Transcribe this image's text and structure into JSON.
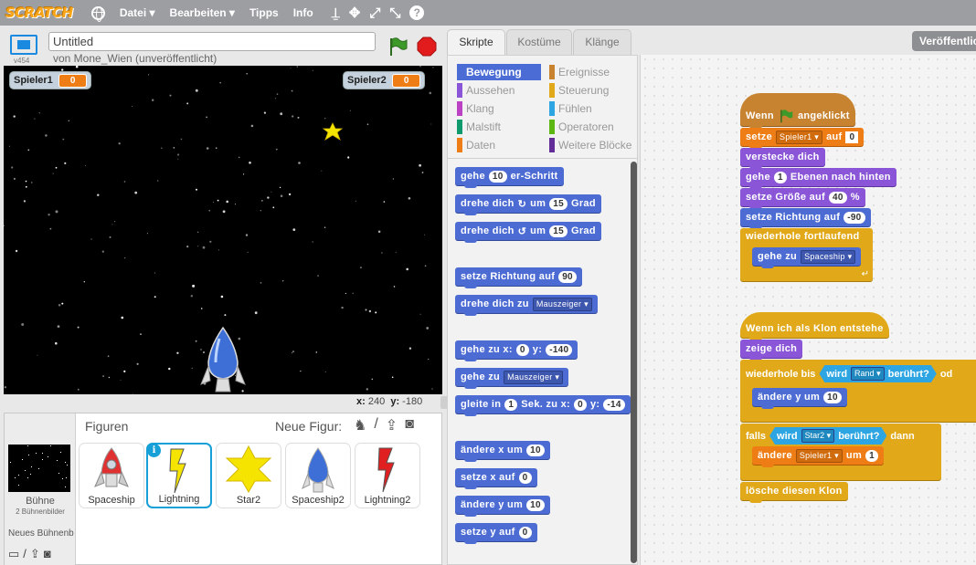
{
  "menubar": {
    "logo": "SCRATCH",
    "items": [
      "Datei ▾",
      "Bearbeiten ▾",
      "Tipps",
      "Info"
    ],
    "tools": [
      "⍊",
      "✥",
      "⤢",
      "⤡"
    ],
    "help": "?"
  },
  "stage_header": {
    "title": "Untitled",
    "author": "von Mone_Wien (unveröffentlicht)",
    "version": "v454"
  },
  "variables": [
    {
      "name": "Spieler1",
      "value": "0"
    },
    {
      "name": "Spieler2",
      "value": "0"
    }
  ],
  "coords": {
    "x_label": "x:",
    "x": "240",
    "y_label": "y:",
    "y": "-180"
  },
  "sprites_pane": {
    "figuren": "Figuren",
    "neue_figur": "Neue Figur:",
    "stage_label": "Bühne",
    "stage_sub": "2 Bühnenbilder",
    "neues_buhnenbild": "Neues Bühnenb",
    "sprites": [
      "Spaceship",
      "Lightning",
      "Star2",
      "Spaceship2",
      "Lightning2"
    ]
  },
  "tabs": [
    "Skripte",
    "Kostüme",
    "Klänge"
  ],
  "publish": "Veröffentlichen",
  "categories": {
    "left": [
      {
        "label": "Bewegung",
        "color": "#4a6cd4"
      },
      {
        "label": "Aussehen",
        "color": "#8a55d7"
      },
      {
        "label": "Klang",
        "color": "#bb42c3"
      },
      {
        "label": "Malstift",
        "color": "#0e9a6c"
      },
      {
        "label": "Daten",
        "color": "#ee7d16"
      }
    ],
    "right": [
      {
        "label": "Ereignisse",
        "color": "#c88330"
      },
      {
        "label": "Steuerung",
        "color": "#e1a91a"
      },
      {
        "label": "Fühlen",
        "color": "#2ca5e2"
      },
      {
        "label": "Operatoren",
        "color": "#5cb712"
      },
      {
        "label": "Weitere Blöcke",
        "color": "#632d99"
      }
    ]
  },
  "palette": {
    "gehe": "gehe",
    "gehe_n": "10",
    "er_schritt": "er-Schritt",
    "drehe_dich": "drehe dich",
    "um": "um",
    "grad": "Grad",
    "n15": "15",
    "setze_richtung": "setze Richtung auf",
    "n90": "90",
    "drehe_zu": "drehe dich zu",
    "mauszeiger": "Mauszeiger",
    "gehe_zu_x": "gehe zu x:",
    "x0": "0",
    "y_lbl": "y:",
    "y140": "-140",
    "gehe_zu": "gehe zu",
    "gleite": "gleite in",
    "n1": "1",
    "sek": "Sek. zu x:",
    "y_short": "-14",
    "aendere_x": "ändere x um",
    "setze_x": "setze x auf",
    "aendere_y": "ändere y um",
    "setze_y": "setze y auf",
    "n10": "10"
  },
  "script1": {
    "wenn": "Wenn",
    "angeklickt": "angeklickt",
    "setze": "setze",
    "var": "Spieler1",
    "auf": "auf",
    "val": "0",
    "verstecke": "verstecke dich",
    "gehe": "gehe",
    "n1": "1",
    "ebenen": "Ebenen nach hinten",
    "groesse": "setze Größe auf",
    "n40": "40",
    "pct": "%",
    "richtung": "setze Richtung auf",
    "n90": "-90",
    "forever": "wiederhole fortlaufend",
    "gehe_zu": "gehe zu",
    "target": "Spaceship"
  },
  "script2": {
    "hat": "Wenn ich als Klon entstehe",
    "zeige": "zeige dich",
    "repeat_until": "wiederhole bis",
    "wird": "wird",
    "rand": "Rand",
    "beruehrt": "berührt?",
    "oder": "od",
    "aendere_y": "ändere y um",
    "n10": "10",
    "falls": "falls",
    "star2": "Star2",
    "dann": "dann",
    "aendere": "ändere",
    "var": "Spieler1",
    "um": "um",
    "n1": "1",
    "loesche": "lösche diesen Klon"
  }
}
